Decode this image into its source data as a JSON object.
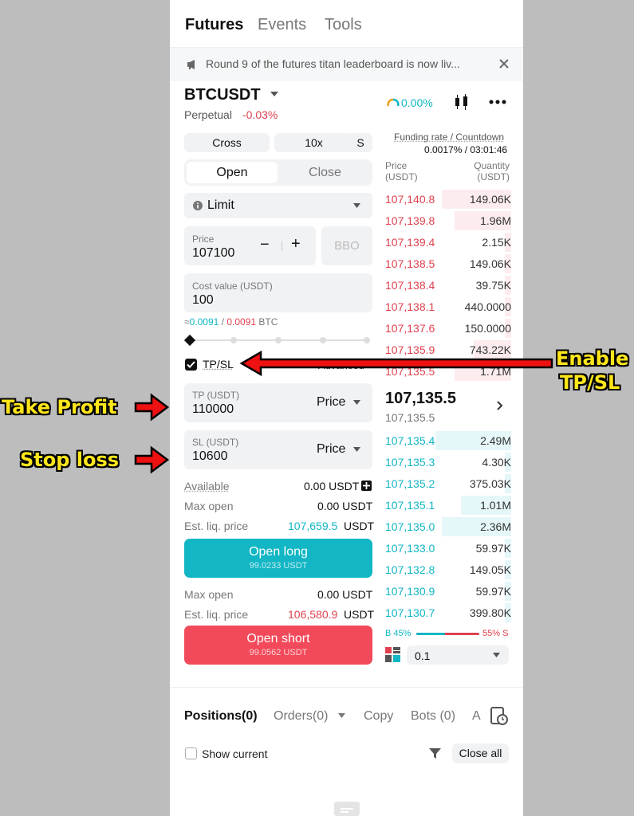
{
  "tabs": [
    "Futures",
    "Events",
    "Tools"
  ],
  "notice": {
    "text": "Round 9 of the futures titan leaderboard is now liv..."
  },
  "symbol": {
    "name": "BTCUSDT",
    "type": "Perpetual",
    "change": "-0.03%",
    "sentiment": "0.00%"
  },
  "funding": {
    "label": "Funding rate / Countdown",
    "value": "0.0017% / 03:01:46"
  },
  "orderbook": {
    "price_header": "Price\n(USDT)",
    "qty_header": "Quantity\n(USDT)",
    "asks": [
      {
        "price": "107,140.8",
        "qty": "149.06K",
        "depth": 0.55
      },
      {
        "price": "107,139.8",
        "qty": "1.96M",
        "depth": 0.45
      },
      {
        "price": "107,139.4",
        "qty": "2.15K",
        "depth": 0.05
      },
      {
        "price": "107,138.5",
        "qty": "149.06K",
        "depth": 0.05
      },
      {
        "price": "107,138.4",
        "qty": "39.75K",
        "depth": 0.05
      },
      {
        "price": "107,138.1",
        "qty": "440.0000",
        "depth": 0.05
      },
      {
        "price": "107,137.6",
        "qty": "150.0000",
        "depth": 0.05
      },
      {
        "price": "107,135.9",
        "qty": "743.22K",
        "depth": 0.3
      },
      {
        "price": "107,135.5",
        "qty": "1.71M",
        "depth": 0.45
      }
    ],
    "last_price": "107,135.5",
    "mark_price": "107,135.5",
    "bids": [
      {
        "price": "107,135.4",
        "qty": "2.49M",
        "depth": 0.6
      },
      {
        "price": "107,135.3",
        "qty": "4.30K",
        "depth": 0.05
      },
      {
        "price": "107,135.2",
        "qty": "375.03K",
        "depth": 0.05
      },
      {
        "price": "107,135.1",
        "qty": "1.01M",
        "depth": 0.4
      },
      {
        "price": "107,135.0",
        "qty": "2.36M",
        "depth": 0.55
      },
      {
        "price": "107,133.0",
        "qty": "59.97K",
        "depth": 0.05
      },
      {
        "price": "107,132.8",
        "qty": "149.05K",
        "depth": 0.05
      },
      {
        "price": "107,130.9",
        "qty": "59.97K",
        "depth": 0.05
      },
      {
        "price": "107,130.7",
        "qty": "399.80K",
        "depth": 0.05
      }
    ],
    "buy_ratio": "B 45%",
    "sell_ratio": "55% S",
    "buy_fraction": 0.45,
    "precision": "0.1"
  },
  "order_form": {
    "margin_mode": "Cross",
    "leverage": "10x",
    "s_label": "S",
    "open_label": "Open",
    "close_label": "Close",
    "order_type": "Limit",
    "price_label": "Price",
    "price_value": "107100",
    "bbo_label": "BBO",
    "cost_label": "Cost value (USDT)",
    "cost_value": "100",
    "approx_prefix": "≈",
    "approx_long": "0.0091",
    "approx_sep": " / ",
    "approx_short": "0.0091",
    "approx_unit": "BTC",
    "tpsl_label": "TP/SL",
    "advanced_label": "Advanced",
    "tp_label": "TP (USDT)",
    "tp_value": "110000",
    "tp_type": "Price",
    "sl_label": "SL (USDT)",
    "sl_value": "10600",
    "sl_type": "Price",
    "available_label": "Available",
    "available_value": "0.00 USDT",
    "max_open_label": "Max open",
    "max_open_long": "0.00 USDT",
    "liq_label": "Est. liq. price",
    "liq_long": "107,659.5",
    "liq_unit": "USDT",
    "open_long_label": "Open long",
    "open_long_sub": "99.0233 USDT",
    "max_open_short": "0.00 USDT",
    "liq_short": "106,580.9",
    "open_short_label": "Open short",
    "open_short_sub": "99.0562 USDT"
  },
  "bottom": {
    "tabs": [
      "Positions(0)",
      "Orders(0)",
      "Copy",
      "Bots (0)",
      "A"
    ],
    "show_current": "Show current",
    "close_all": "Close all"
  },
  "annotations": {
    "enable": "Enable",
    "tpsl": "TP/SL",
    "take_profit": "Take Profit",
    "stop_loss": "Stop loss"
  },
  "colors": {
    "red": "#e0414f",
    "teal": "#12b6c4",
    "annotation_text": "#ffe61a",
    "arrow": "#ee1111"
  }
}
